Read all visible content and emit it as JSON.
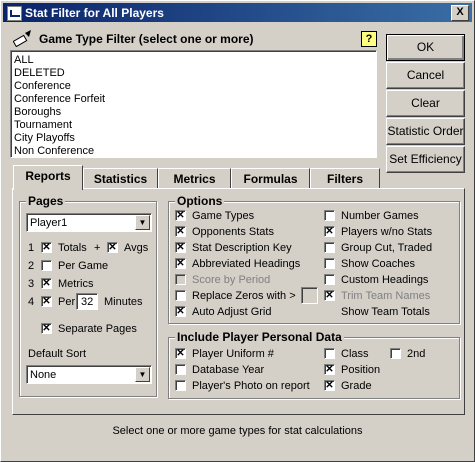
{
  "window": {
    "title": "Stat Filter for All Players",
    "close_label": "X"
  },
  "game_type_filter": {
    "label": "Game Type Filter (select one or more)",
    "help_label": "?",
    "items": [
      "ALL",
      "DELETED",
      "Conference",
      "Conference Forfeit",
      "Boroughs",
      "Tournament",
      "City Playoffs",
      "Non Conference"
    ]
  },
  "buttons": {
    "ok": "OK",
    "cancel": "Cancel",
    "clear": "Clear",
    "statistic_order": "Statistic Order",
    "set_efficiency": "Set Efficiency"
  },
  "tabs": [
    "Reports",
    "Statistics",
    "Metrics",
    "Formulas",
    "Filters"
  ],
  "active_tab": "Reports",
  "pages": {
    "title": "Pages",
    "selected": "Player1",
    "row1": {
      "num": "1",
      "totals": "Totals",
      "plus": "+",
      "avgs": "Avgs",
      "totals_checked": true,
      "avgs_checked": true
    },
    "row2": {
      "num": "2",
      "label": "Per Game",
      "checked": false
    },
    "row3": {
      "num": "3",
      "label": "Metrics",
      "checked": true
    },
    "row4": {
      "num": "4",
      "per": "Per",
      "minutes_value": "32",
      "minutes": "Minutes",
      "checked": true
    },
    "separate": {
      "label": "Separate Pages",
      "checked": true
    },
    "default_sort_label": "Default Sort",
    "default_sort_value": "None"
  },
  "options": {
    "title": "Options",
    "left": [
      {
        "label": "Game Types",
        "checked": true,
        "disabled": false
      },
      {
        "label": "Opponents Stats",
        "checked": true,
        "disabled": false
      },
      {
        "label": "Stat Description Key",
        "checked": true,
        "disabled": false
      },
      {
        "label": "Abbreviated Headings",
        "checked": true,
        "disabled": false
      },
      {
        "label": "Score by Period",
        "checked": false,
        "disabled": true
      },
      {
        "label": "Replace Zeros with >",
        "checked": false,
        "disabled": false
      },
      {
        "label": "Auto Adjust Grid",
        "checked": true,
        "disabled": false
      }
    ],
    "right": [
      {
        "label": "Number Games",
        "checked": false,
        "disabled": false
      },
      {
        "label": "Players w/no Stats",
        "checked": true,
        "disabled": false
      },
      {
        "label": "Group Cut, Traded",
        "checked": false,
        "disabled": false
      },
      {
        "label": "Show Coaches",
        "checked": false,
        "disabled": false
      },
      {
        "label": "Custom Headings",
        "checked": false,
        "disabled": false
      },
      {
        "label": "Trim Team Names",
        "checked": true,
        "disabled": true
      }
    ],
    "show_team_totals": "Show Team Totals"
  },
  "personal": {
    "title": "Include Player Personal Data",
    "left": [
      {
        "label": "Player Uniform #",
        "checked": true
      },
      {
        "label": "Database Year",
        "checked": false
      },
      {
        "label": "Player's Photo on report",
        "checked": false
      }
    ],
    "right": [
      {
        "label": "Class",
        "checked": false
      },
      {
        "label": "Position",
        "checked": true
      },
      {
        "label": "Grade",
        "checked": true
      }
    ],
    "second": {
      "label": "2nd",
      "checked": false
    }
  },
  "status_text": "Select one or more game types for stat calculations"
}
